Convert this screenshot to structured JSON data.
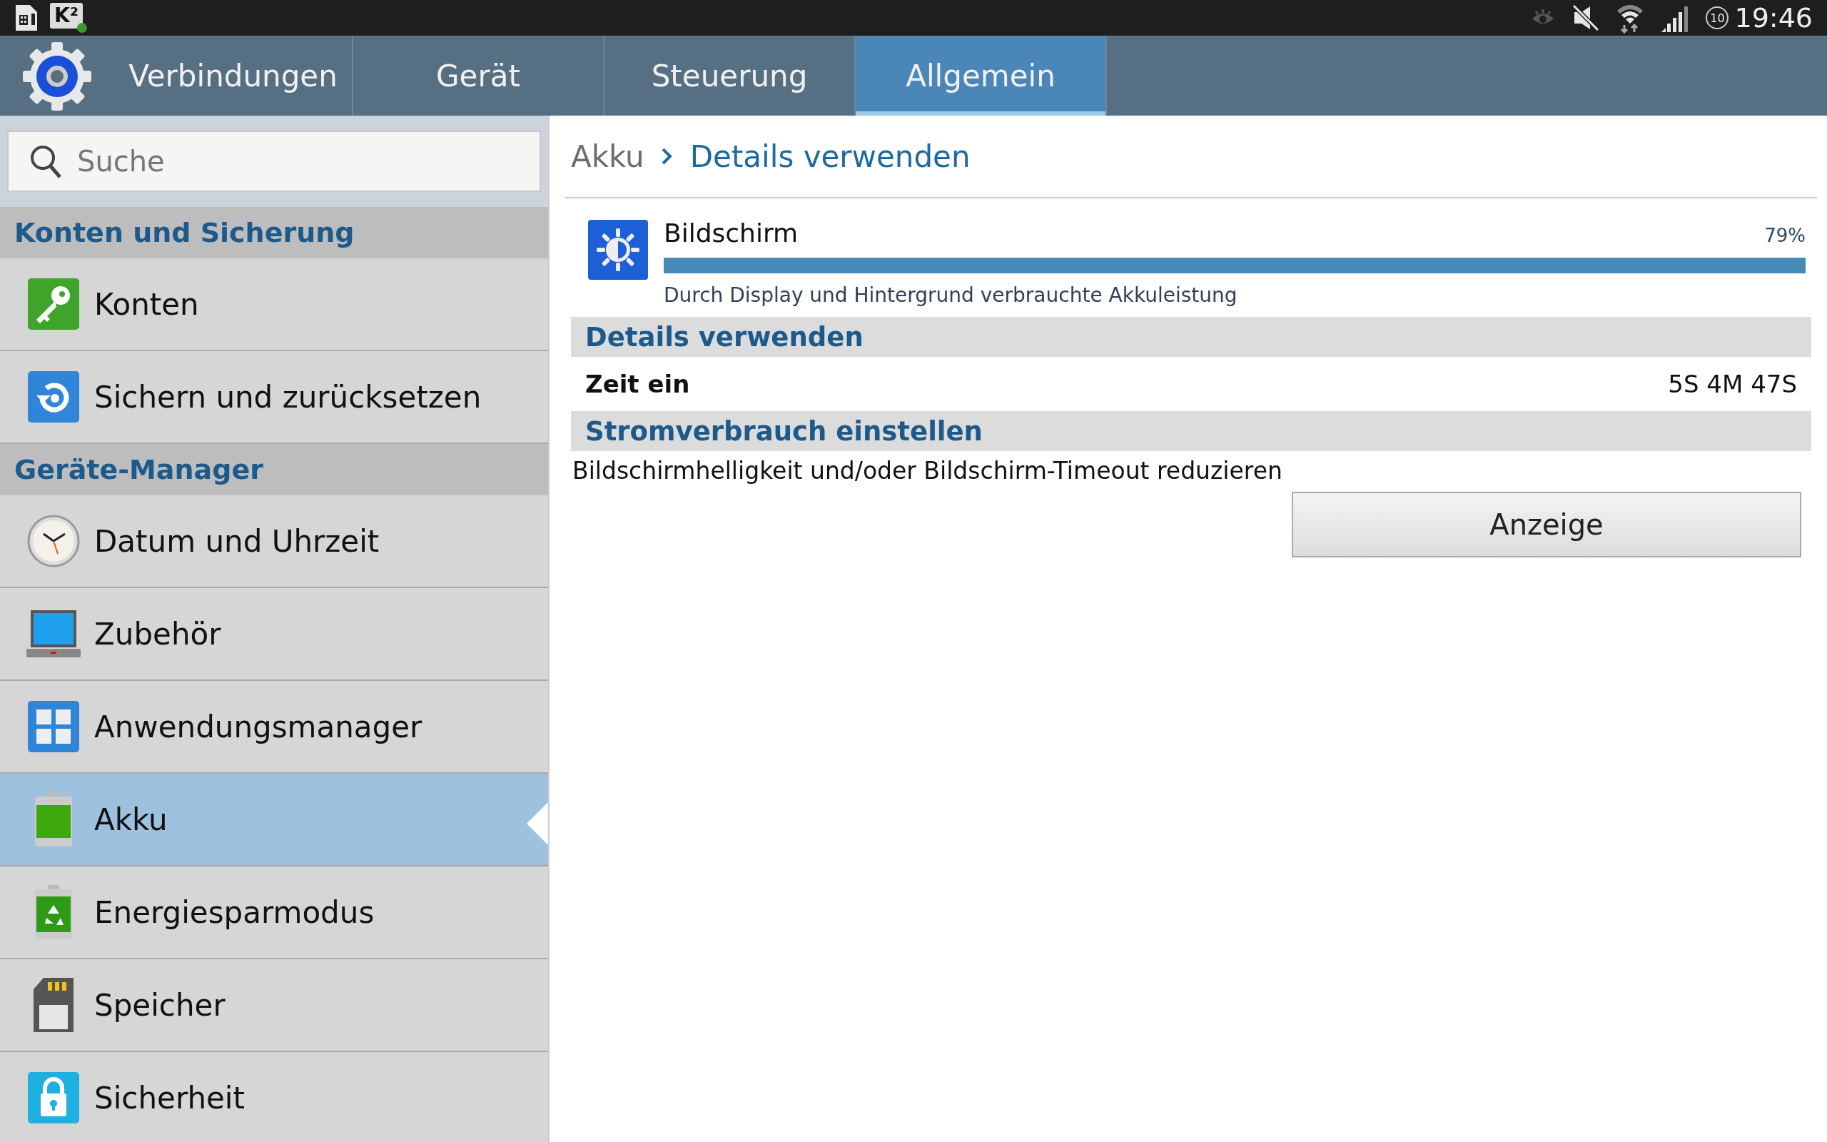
{
  "status_bar": {
    "app_badge": "K²",
    "timer_badge": "10",
    "time": "19:46"
  },
  "tabs": [
    {
      "label": "Verbindungen",
      "selected": false
    },
    {
      "label": "Gerät",
      "selected": false
    },
    {
      "label": "Steuerung",
      "selected": false
    },
    {
      "label": "Allgemein",
      "selected": true
    }
  ],
  "search": {
    "placeholder": "Suche"
  },
  "sidebar": {
    "items": [
      {
        "kind": "header",
        "label": "Konten und Sicherung"
      },
      {
        "kind": "item",
        "label": "Konten",
        "selected": false
      },
      {
        "kind": "item",
        "label": "Sichern und zurücksetzen",
        "selected": false
      },
      {
        "kind": "header",
        "label": "Geräte-Manager"
      },
      {
        "kind": "item",
        "label": "Datum und Uhrzeit",
        "selected": false
      },
      {
        "kind": "item",
        "label": "Zubehör",
        "selected": false
      },
      {
        "kind": "item",
        "label": "Anwendungsmanager",
        "selected": false
      },
      {
        "kind": "item",
        "label": "Akku",
        "selected": true
      },
      {
        "kind": "item",
        "label": "Energiesparmodus",
        "selected": false
      },
      {
        "kind": "item",
        "label": "Speicher",
        "selected": false
      },
      {
        "kind": "item",
        "label": "Sicherheit",
        "selected": false
      }
    ]
  },
  "breadcrumb": [
    "Akku",
    "Details verwenden"
  ],
  "usage": {
    "name": "Bildschirm",
    "percent": "79%",
    "level": 1.0,
    "description": "Durch Display und Hintergrund verbrauchte Akkuleistung"
  },
  "details": {
    "heading": "Details verwenden",
    "label": "Zeit ein",
    "value": "5S 4M 47S"
  },
  "power": {
    "heading": "Stromverbrauch einstellen",
    "text": "Bildschirmhelligkeit und/oder Bildschirm-Timeout reduzieren",
    "button": "Anzeige"
  }
}
